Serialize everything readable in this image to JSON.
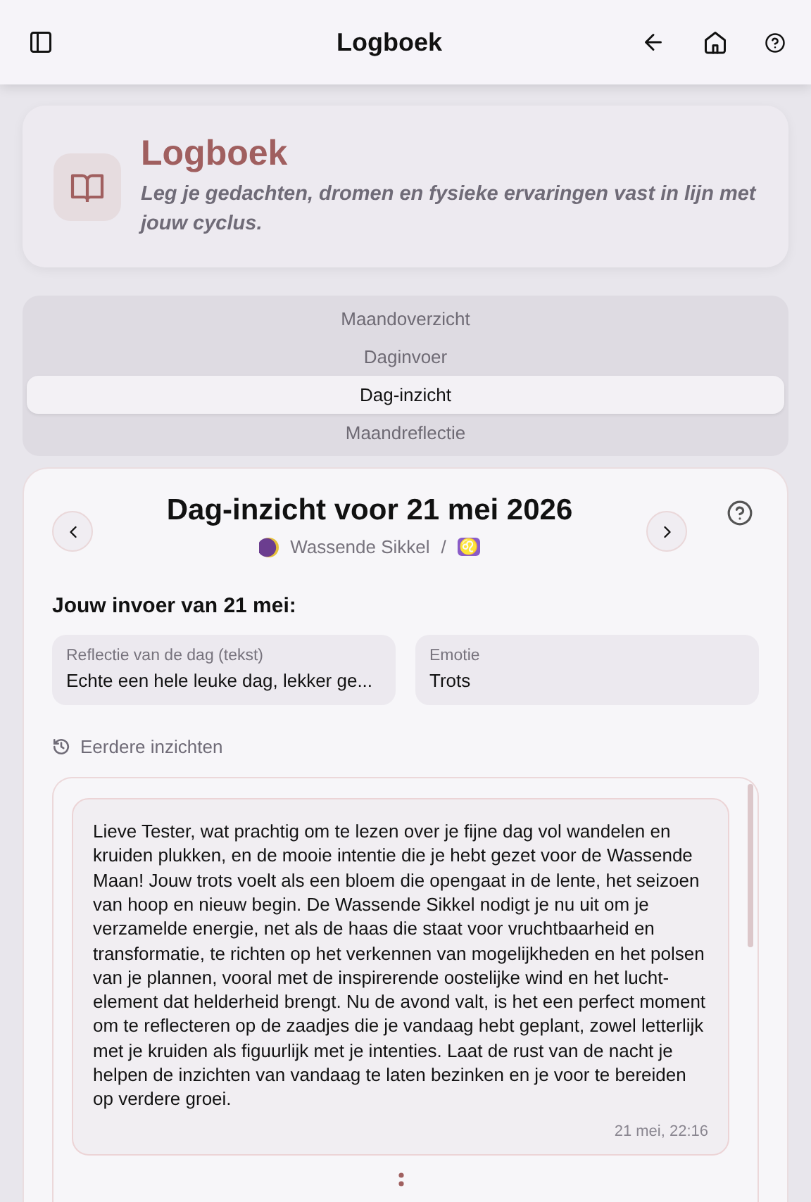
{
  "top_bar": {
    "title": "Logboek"
  },
  "header": {
    "title": "Logboek",
    "subtitle": "Leg je gedachten, dromen en fysieke ervaringen vast in lijn met jouw cyclus."
  },
  "tabs": [
    {
      "label": "Maandoverzicht",
      "selected": false
    },
    {
      "label": "Daginvoer",
      "selected": false
    },
    {
      "label": "Dag-inzicht",
      "selected": true
    },
    {
      "label": "Maandreflectie",
      "selected": false
    }
  ],
  "insight": {
    "title": "Dag-inzicht voor 21 mei 2026",
    "moon_phase": "Wassende Sikkel",
    "separator": "/",
    "zodiac": "♌",
    "entry_heading": "Jouw invoer van 21 mei:",
    "fields": [
      {
        "label": "Reflectie van de dag (tekst)",
        "value": "Echte een hele leuke dag, lekker ge..."
      },
      {
        "label": "Emotie",
        "value": "Trots"
      }
    ],
    "history_label": "Eerdere inzichten",
    "messages": [
      {
        "text": "Lieve Tester, wat prachtig om te lezen over je fijne dag vol wandelen en kruiden plukken, en de mooie intentie die je hebt gezet voor de Wassende Maan! Jouw trots voelt als een bloem die opengaat in de lente, het seizoen van hoop en nieuw begin. De Wassende Sikkel nodigt je nu uit om je verzamelde energie, net als de haas die staat voor vruchtbaarheid en transformatie, te richten op het verkennen van mogelijkheden en het polsen van je plannen, vooral met de inspirerende oostelijke wind en het lucht-element dat helderheid brengt. Nu de avond valt, is het een perfect moment om te reflecteren op de zaadjes die je vandaag hebt geplant, zowel letterlijk met je kruiden als figuurlijk met je intenties. Laat de rust van de nacht je helpen de inzichten van vandaag te laten bezinken en je voor te bereiden op verdere groei.",
        "time": "21 mei, 22:16"
      }
    ]
  }
}
